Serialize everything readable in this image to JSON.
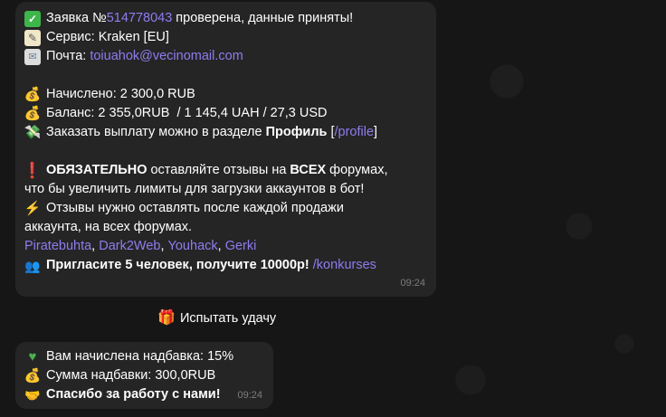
{
  "message1": {
    "line1": {
      "prefix": "Заявка №",
      "order_id": "514778043",
      "suffix": " проверена, данные приняты!"
    },
    "line2": "Сервис: Kraken [EU]",
    "line3": {
      "label": "Почта: ",
      "email": "toiuahok@vecinomail.com"
    },
    "line4": "Начислено: 2 300,0 RUB",
    "line5": "Баланс: 2 355,0RUB  / 1 145,4 UAH / 27,3 USD",
    "line6": {
      "text": "Заказать выплату можно в разделе ",
      "bold": "Профиль",
      "bracket_open": " [",
      "cmd": "/profile",
      "bracket_close": "]"
    },
    "line7": {
      "bold": "ОБЯЗАТЕЛЬНО",
      "text": " оставляйте отзывы на ",
      "bold2": "ВСЕХ",
      "text2": " форумах,"
    },
    "line8": "что бы увеличить лимиты для загрузки аккаунтов в бот!",
    "line9": "Отзывы нужно оставлять после каждой продажи",
    "line10": "аккаунта, на всех форумах.",
    "forums": [
      "Piratebuhta",
      "Dark2Web",
      "Youhack",
      "Gerki"
    ],
    "line12": {
      "text": "Пригласите 5 человек, получите 10000р! ",
      "cmd": "/konkurses"
    },
    "time": "09:24"
  },
  "inline_button": {
    "label": "Испытать удачу"
  },
  "message2": {
    "line1": "Вам начислена надбавка: 15%",
    "line2": "Сумма надбавки: 300,0RUB",
    "line3": "Спасибо за работу с нами!",
    "time": "09:24"
  },
  "colors": {
    "link": "#8f7cf0",
    "bubble": "#252525",
    "background": "#161616"
  },
  "icons": [
    "check-mark-icon",
    "memo-icon",
    "envelope-icon",
    "money-bag-icon",
    "money-wings-icon",
    "exclamation-icon",
    "lightning-icon",
    "people-icon",
    "gift-icon",
    "green-heart-icon",
    "handshake-icon"
  ]
}
